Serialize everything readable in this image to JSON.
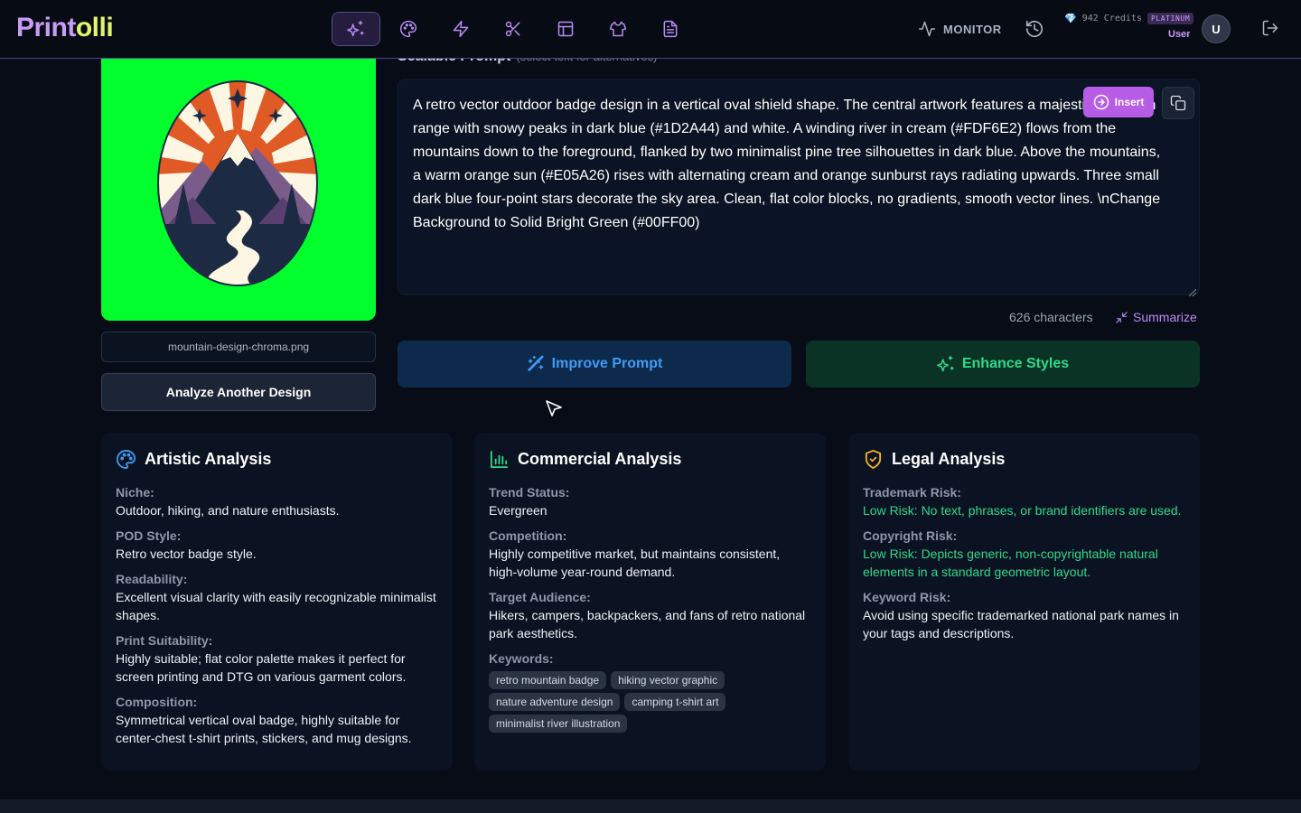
{
  "brand": {
    "logo_main": "Print",
    "logo_accent": "olli"
  },
  "nav": {
    "icons": [
      "sparkles-icon",
      "palette-icon",
      "bolt-icon",
      "scissors-icon",
      "layout-icon",
      "tshirt-icon",
      "document-icon"
    ],
    "monitor_label": "MONITOR",
    "credits": "942 Credits",
    "plan": "PLATINUM",
    "role": "User",
    "avatar_initial": "U"
  },
  "left": {
    "filename": "mountain-design-chroma.png",
    "analyze_button": "Analyze Another Design"
  },
  "prompt": {
    "heading": "Scalable Prompt",
    "subheading": "(select text for alternatives)",
    "text": "A retro vector outdoor badge design in a vertical oval shield shape. The central artwork features a majestic mountain range with snowy peaks in dark blue (#1D2A44) and white. A winding river in cream (#FDF6E2) flows from the mountains down to the foreground, flanked by two minimalist pine tree silhouettes in dark blue. Above the mountains, a warm orange sun (#E05A26) rises with alternating cream and orange sunburst rays radiating upwards. Three small dark blue four-point stars decorate the sky area. Clean, flat color blocks, no gradients, smooth vector lines. \\nChange Background to Solid Bright Green (#00FF00)",
    "insert_label": "Insert",
    "char_count": "626 characters",
    "summarize_label": "Summarize",
    "improve_label": "Improve Prompt",
    "enhance_label": "Enhance Styles"
  },
  "artistic": {
    "title": "Artistic Analysis",
    "fields": [
      {
        "label": "Niche:",
        "value": "Outdoor, hiking, and nature enthusiasts."
      },
      {
        "label": "POD Style:",
        "value": "Retro vector badge style."
      },
      {
        "label": "Readability:",
        "value": "Excellent visual clarity with easily recognizable minimalist shapes."
      },
      {
        "label": "Print Suitability:",
        "value": "Highly suitable; flat color palette makes it perfect for screen printing and DTG on various garment colors."
      },
      {
        "label": "Composition:",
        "value": "Symmetrical vertical oval badge, highly suitable for center-chest t-shirt prints, stickers, and mug designs."
      }
    ]
  },
  "commercial": {
    "title": "Commercial Analysis",
    "fields": [
      {
        "label": "Trend Status:",
        "value": "Evergreen"
      },
      {
        "label": "Competition:",
        "value": "Highly competitive market, but maintains consistent, high-volume year-round demand."
      },
      {
        "label": "Target Audience:",
        "value": "Hikers, campers, backpackers, and fans of retro national park aesthetics."
      }
    ],
    "keywords_label": "Keywords:",
    "keywords": [
      "retro mountain badge",
      "hiking vector graphic",
      "nature adventure design",
      "camping t-shirt art",
      "minimalist river illustration"
    ]
  },
  "legal": {
    "title": "Legal Analysis",
    "fields": [
      {
        "label": "Trademark Risk:",
        "value": "Low Risk: No text, phrases, or brand identifiers are used."
      },
      {
        "label": "Copyright Risk:",
        "value": "Low Risk: Depicts generic, non-copyrightable natural elements in a standard geometric layout."
      },
      {
        "label": "Keyword Risk:",
        "value": "Avoid using specific trademarked national park names in your tags and descriptions."
      }
    ]
  },
  "colors": {
    "accent_purple": "#b65ce6",
    "improve_blue": "#3e9cf6",
    "enhance_green": "#2fd98a",
    "preview_bg": "#00ff2c",
    "legal_amber": "#f5b324"
  }
}
